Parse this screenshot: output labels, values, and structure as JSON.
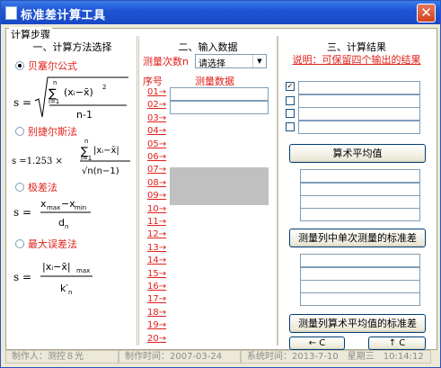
{
  "window": {
    "title": "标准差计算工具"
  },
  "frame_legend": "计算步骤",
  "panel1": {
    "heading": "一、计算方法选择",
    "methods": [
      {
        "label": "贝塞尔公式",
        "selected": true
      },
      {
        "label": "别捷尔斯法",
        "selected": false
      },
      {
        "label": "极差法",
        "selected": false
      },
      {
        "label": "最大误差法",
        "selected": false
      }
    ],
    "formula_prefix": {
      "s": "s =",
      "s1253": "s =1.253 ×"
    },
    "formula_terms": {
      "sum_top": "n",
      "sum_bottom": "i=1",
      "sum_sign": "∑",
      "xi_minus_xbar": "(xᵢ−x̄)",
      "sq": "2",
      "n_minus_1": "n-1",
      "abs_xi": "|xᵢ−x̄|",
      "sqrt_nn1": "√n(n−1)",
      "xmax_xmin": "xmax −xmin",
      "dn": "dn",
      "abs_max": "|xᵢ−x̄|max",
      "kn": "k′n"
    }
  },
  "panel2": {
    "heading": "二、输入数据",
    "count_label": "测量次数n",
    "select_value": "请选择",
    "seq_header": "序号",
    "data_header": "测量数据",
    "seq": [
      "01→",
      "02→",
      "03→",
      "04→",
      "05→",
      "06→",
      "07→",
      "08→",
      "09→",
      "10→",
      "11→",
      "12→",
      "13→",
      "14→",
      "15→",
      "16→",
      "17→",
      "18→",
      "19→",
      "20→"
    ]
  },
  "panel3": {
    "heading": "三、计算结果",
    "note": "说明：可保留四个输出的结果",
    "btn_mean": "算术平均值",
    "btn_single_std": "测量列中单次测量的标准差",
    "btn_mean_std": "测量列算术平均值的标准差",
    "btn_left": "← C",
    "btn_up": "↑ C",
    "checked_mark": "✓"
  },
  "status": {
    "author": "制作人：测控８光",
    "made": "制作时间：2007-03-24",
    "sys": "系统时间：2013-7-10　星期三　10:14:12"
  }
}
